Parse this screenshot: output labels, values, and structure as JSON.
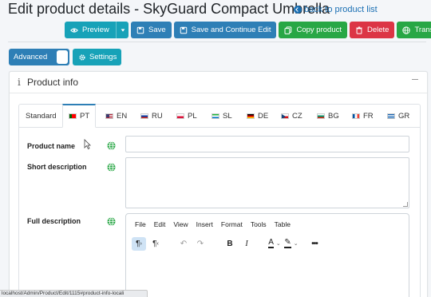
{
  "header": {
    "title": "Edit product details - SkyGuard Compact Umbrella",
    "back_link": "back to product list"
  },
  "toolbar": {
    "preview": "Preview",
    "save": "Save",
    "save_continue": "Save and Continue Edit",
    "copy": "Copy product",
    "delete": "Delete",
    "translate": "Translate"
  },
  "mode": {
    "advanced": "Advanced",
    "settings": "Settings"
  },
  "card": {
    "title": "Product info"
  },
  "tabs": [
    {
      "label": "Standard"
    },
    {
      "label": "PT"
    },
    {
      "label": "EN"
    },
    {
      "label": "RU"
    },
    {
      "label": "PL"
    },
    {
      "label": "SL"
    },
    {
      "label": "DE"
    },
    {
      "label": "CZ"
    },
    {
      "label": "BG"
    },
    {
      "label": "FR"
    },
    {
      "label": "GR"
    }
  ],
  "form": {
    "product_name_label": "Product name",
    "product_name_value": "",
    "short_description_label": "Short description",
    "short_description_value": "",
    "full_description_label": "Full description"
  },
  "editor": {
    "menu": [
      "File",
      "Edit",
      "View",
      "Insert",
      "Format",
      "Tools",
      "Table"
    ]
  },
  "status_bar": {
    "url": "localhost/Admin/Product/Edit/1115#product-info-locali"
  },
  "colors": {
    "primary": "#2e7fb6",
    "info": "#17a2b8",
    "success": "#28a745",
    "danger": "#dc3545",
    "globe": "#28a745"
  }
}
